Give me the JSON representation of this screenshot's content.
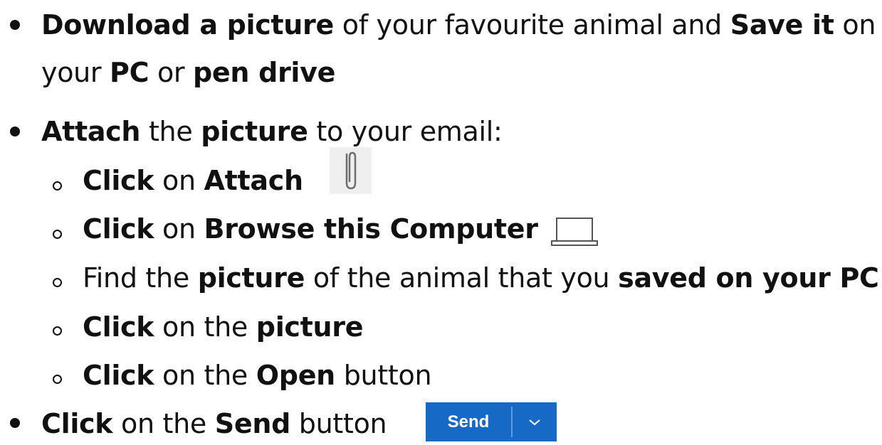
{
  "steps": [
    {
      "parts": [
        {
          "text": "Download a picture",
          "bold": true
        },
        {
          "text": " of your favourite animal and ",
          "bold": false
        },
        {
          "text": "Save it",
          "bold": true
        },
        {
          "text": " on",
          "bold": false
        }
      ]
    },
    {
      "parts": [
        {
          "text": "your ",
          "bold": false
        },
        {
          "text": "PC",
          "bold": true
        },
        {
          "text": " or ",
          "bold": false
        },
        {
          "text": "pen drive",
          "bold": true
        }
      ]
    },
    {
      "parts": [
        {
          "text": "Attach",
          "bold": true
        },
        {
          "text": " the ",
          "bold": false
        },
        {
          "text": "picture",
          "bold": true
        },
        {
          "text": " to your email:",
          "bold": false
        }
      ]
    },
    {
      "parts": [
        {
          "text": "Click",
          "bold": true
        },
        {
          "text": " on ",
          "bold": false
        },
        {
          "text": "Attach",
          "bold": true
        }
      ]
    },
    {
      "parts": [
        {
          "text": "Click",
          "bold": true
        },
        {
          "text": " on ",
          "bold": false
        },
        {
          "text": "Browse this Computer",
          "bold": true
        }
      ]
    },
    {
      "parts": [
        {
          "text": "Find the ",
          "bold": false
        },
        {
          "text": "picture",
          "bold": true
        },
        {
          "text": " of the animal that you ",
          "bold": false
        },
        {
          "text": "saved on your PC",
          "bold": true
        }
      ]
    },
    {
      "parts": [
        {
          "text": "Click",
          "bold": true
        },
        {
          "text": " on the ",
          "bold": false
        },
        {
          "text": "picture",
          "bold": true
        }
      ]
    },
    {
      "parts": [
        {
          "text": "Click",
          "bold": true
        },
        {
          "text": " on the ",
          "bold": false
        },
        {
          "text": "Open",
          "bold": true
        },
        {
          "text": " button",
          "bold": false
        }
      ]
    },
    {
      "parts": [
        {
          "text": "Click",
          "bold": true
        },
        {
          "text": " on the ",
          "bold": false
        },
        {
          "text": "Send",
          "bold": true
        },
        {
          "text": " button",
          "bold": false
        }
      ]
    }
  ],
  "icons": {
    "attach": "paperclip-icon",
    "browse": "laptop-icon",
    "send_dropdown": "chevron-down-icon"
  },
  "send_button": {
    "label": "Send",
    "color": "#1769c6"
  }
}
